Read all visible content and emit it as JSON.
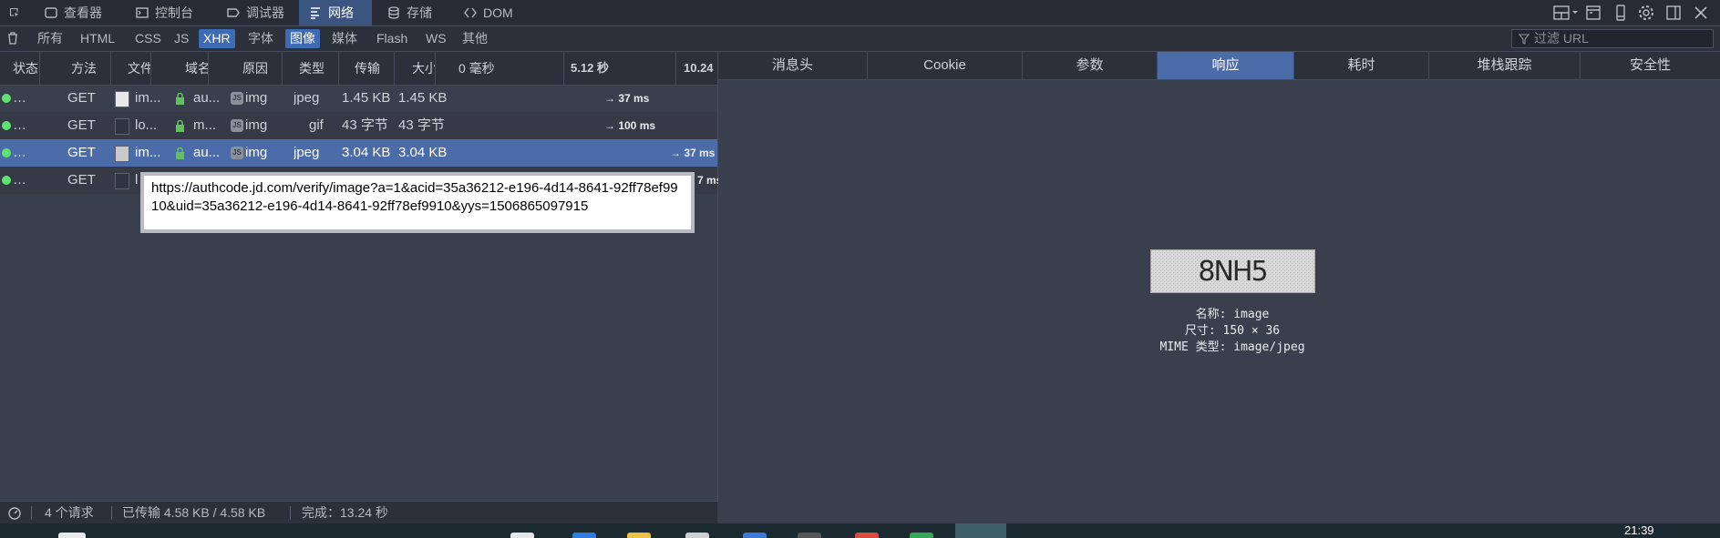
{
  "toolbox": {
    "tabs": [
      {
        "label": "查看器",
        "icon": "inspector-icon"
      },
      {
        "label": "控制台",
        "icon": "console-icon"
      },
      {
        "label": "调试器",
        "icon": "debugger-icon"
      },
      {
        "label": "网络",
        "icon": "network-icon",
        "selected": true
      },
      {
        "label": "存储",
        "icon": "storage-icon"
      },
      {
        "label": "DOM",
        "icon": "dom-icon"
      }
    ]
  },
  "filters": {
    "buttons": [
      "所有",
      "HTML",
      "CSS",
      "JS",
      "XHR",
      "字体",
      "图像",
      "媒体",
      "Flash",
      "WS",
      "其他"
    ],
    "active": [
      "XHR",
      "图像"
    ],
    "url_placeholder": "过滤 URL"
  },
  "columns": [
    "状态",
    "方法",
    "文件",
    "域名",
    "原因",
    "类型",
    "传输",
    "大小"
  ],
  "timeline_ticks": [
    "0 毫秒",
    "5.12 秒",
    "10.24"
  ],
  "requests": [
    {
      "method": "GET",
      "file": "im...",
      "domain": "au...",
      "cause": "img",
      "type": "jpeg",
      "transferred": "1.45 KB",
      "size": "1.45 KB",
      "timing": "→ 37 ms",
      "secure": true
    },
    {
      "method": "GET",
      "file": "lo...",
      "domain": "m...",
      "cause": "img",
      "type": "gif",
      "transferred": "43 字节",
      "size": "43 字节",
      "timing": "→ 100 ms",
      "secure": true
    },
    {
      "method": "GET",
      "file": "im...",
      "domain": "au...",
      "cause": "img",
      "type": "jpeg",
      "transferred": "3.04 KB",
      "size": "3.04 KB",
      "timing": "→ 37 ms",
      "secure": true,
      "selected": true
    },
    {
      "method": "GET",
      "file": "l",
      "timing": "7 ms"
    }
  ],
  "tooltip": "https://authcode.jd.com/verify/image?a=1&acid=35a36212-e196-4d14-8641-92ff78ef9910&uid=35a36212-e196-4d14-8641-92ff78ef9910&yys=1506865097915",
  "status": {
    "requests": "4 个请求",
    "transferred": "已传输 4.58 KB / 4.58 KB",
    "finished": "完成：13.24 秒"
  },
  "details": {
    "tabs": [
      "消息头",
      "Cookie",
      "参数",
      "响应",
      "耗时",
      "堆栈跟踪",
      "安全性"
    ],
    "selected_tab": "响应",
    "captcha_text": "8NH5",
    "image_info": {
      "name": "名称: image",
      "size": "尺寸:  150 × 36",
      "mime": "MIME 类型: image/jpeg"
    }
  },
  "taskbar": {
    "clock": "21:39"
  }
}
